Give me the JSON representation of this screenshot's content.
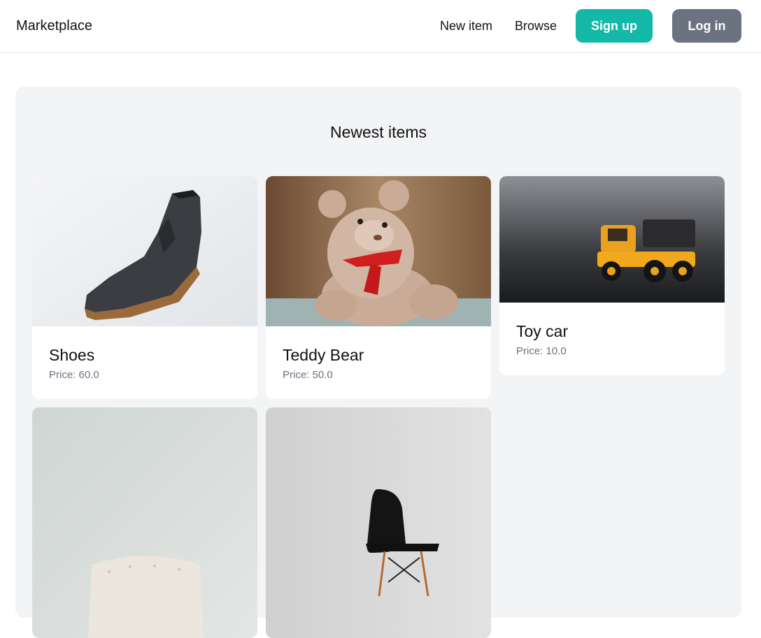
{
  "nav": {
    "brand": "Marketplace",
    "links": [
      "New item",
      "Browse"
    ],
    "signup_label": "Sign up",
    "login_label": "Log in"
  },
  "main": {
    "title": "Newest items",
    "items": [
      {
        "name": "Shoes",
        "price": "Price: 60.0",
        "image": "shoe-image"
      },
      {
        "name": "Teddy Bear",
        "price": "Price: 50.0",
        "image": "teddy-bear-image"
      },
      {
        "name": "Toy car",
        "price": "Price: 10.0",
        "image": "toy-truck-image"
      },
      {
        "name": "",
        "price": "",
        "image": "armchair-image"
      },
      {
        "name": "",
        "price": "",
        "image": "chair-image"
      }
    ]
  },
  "colors": {
    "signup": "#14b8a6",
    "login": "#6b7280",
    "panel": "#f3f4f6"
  }
}
